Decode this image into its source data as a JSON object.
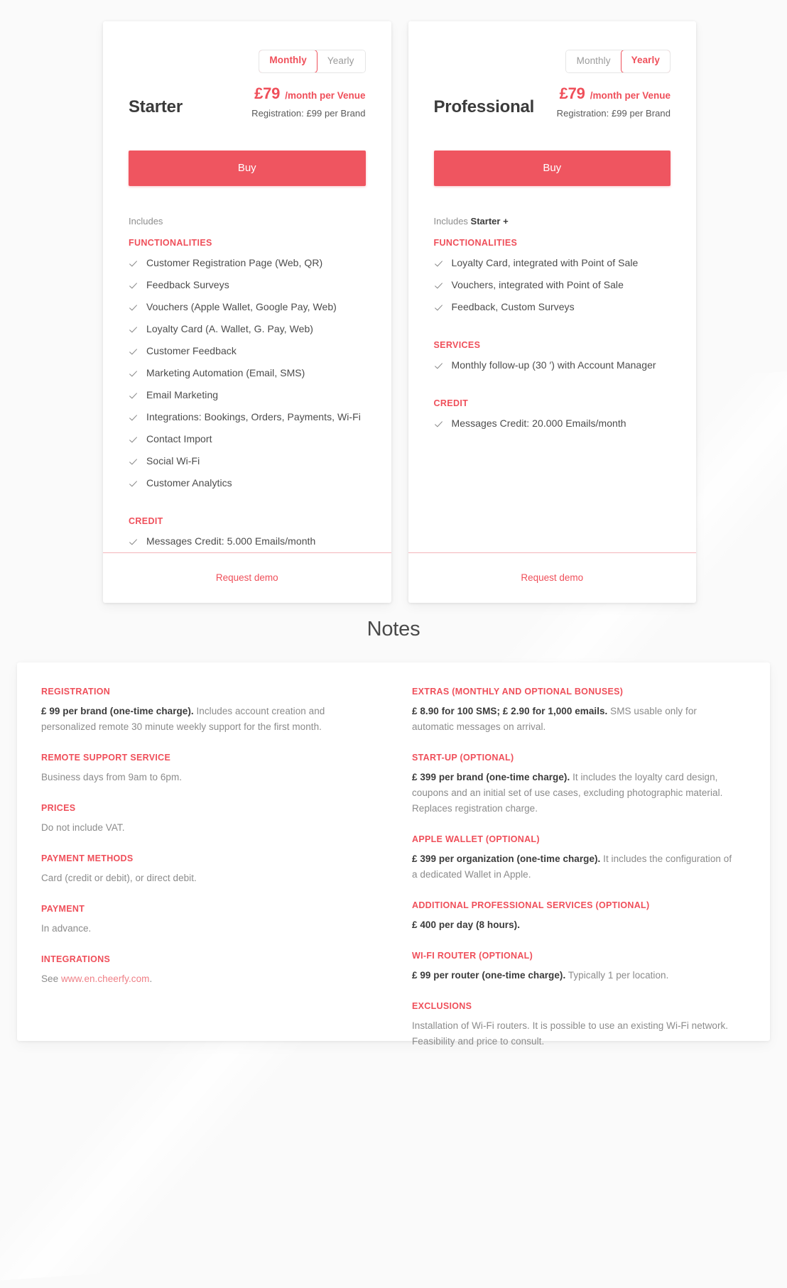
{
  "theme": {
    "accent": "#ef4f5a",
    "button": "#ef5560",
    "page_bg": "#fafafa",
    "card_bg": "#ffffff",
    "text": "#4c4c4c",
    "muted": "#8b8b8b"
  },
  "plans": [
    {
      "name": "Starter",
      "billing_toggle": {
        "monthly": "Monthly",
        "yearly": "Yearly",
        "selected": "Monthly"
      },
      "price_amount": "£79",
      "price_unit": "/month per Venue",
      "registration": "Registration: £99 per Brand",
      "buy_label": "Buy",
      "includes_prefix": "Includes",
      "includes_strong": "",
      "sections": [
        {
          "title": "FUNCTIONALITIES",
          "items": [
            "Customer Registration Page (Web, QR)",
            "Feedback Surveys",
            "Vouchers (Apple Wallet, Google Pay, Web)",
            "Loyalty Card (A. Wallet, G. Pay, Web)",
            "Customer Feedback",
            "Marketing Automation (Email, SMS)",
            "Email Marketing",
            "Integrations: Bookings, Orders, Payments, Wi-Fi",
            "Contact Import",
            "Social Wi-Fi",
            "Customer Analytics"
          ]
        },
        {
          "title": "CREDIT",
          "items": [
            "Messages Credit: 5.000 Emails/month"
          ]
        }
      ],
      "demo_label": "Request demo"
    },
    {
      "name": "Professional",
      "billing_toggle": {
        "monthly": "Monthly",
        "yearly": "Yearly",
        "selected": "Yearly"
      },
      "price_amount": "£79",
      "price_unit": "/month per Venue",
      "registration": "Registration: £99 per Brand",
      "buy_label": "Buy",
      "includes_prefix": "Includes",
      "includes_strong": "Starter +",
      "sections": [
        {
          "title": "FUNCTIONALITIES",
          "items": [
            "Loyalty Card, integrated with Point of Sale",
            "Vouchers, integrated with Point of Sale",
            "Feedback, Custom Surveys"
          ]
        },
        {
          "title": "SERVICES",
          "items": [
            "Monthly follow-up (30 ′) with Account Manager"
          ]
        },
        {
          "title": "CREDIT",
          "items": [
            "Messages Credit: 20.000 Emails/month"
          ]
        }
      ],
      "demo_label": "Request demo"
    }
  ],
  "notes": {
    "title": "Notes",
    "left": [
      {
        "head": "REGISTRATION",
        "strong": "£ 99 per brand (one-time charge).",
        "rest": " Includes account creation and personalized remote 30 minute weekly support for the first month."
      },
      {
        "head": "REMOTE SUPPORT SERVICE",
        "strong": "",
        "rest": "Business days from 9am to 6pm."
      },
      {
        "head": "PRICES",
        "strong": "",
        "rest": "Do not include VAT."
      },
      {
        "head": "PAYMENT METHODS",
        "strong": "",
        "rest": "Card (credit or debit), or direct debit."
      },
      {
        "head": "PAYMENT",
        "strong": "",
        "rest": "In advance."
      },
      {
        "head": "INTEGRATIONS",
        "strong": "",
        "rest": "See ",
        "link": "www.en.cheerfy.com",
        "after_link": "."
      }
    ],
    "right": [
      {
        "head": "EXTRAS (MONTHLY AND OPTIONAL BONUSES)",
        "strong": "£ 8.90 for 100 SMS; £ 2.90 for 1,000 emails.",
        "rest": " SMS usable only for automatic messages on arrival."
      },
      {
        "head": "START-UP (OPTIONAL)",
        "strong": "£ 399 per brand (one-time charge).",
        "rest": " It includes the loyalty card design, coupons and an initial set of use cases, excluding photographic material. Replaces registration charge."
      },
      {
        "head": "APPLE WALLET (OPTIONAL)",
        "strong": "£ 399 per organization (one-time charge).",
        "rest": " It includes the configuration of a dedicated Wallet in Apple."
      },
      {
        "head": "ADDITIONAL PROFESSIONAL SERVICES (OPTIONAL)",
        "strong": "£ 400 per day (8 hours).",
        "rest": ""
      },
      {
        "head": "WI-FI ROUTER (OPTIONAL)",
        "strong": "£ 99 per router (one-time charge).",
        "rest": " Typically 1 per location."
      },
      {
        "head": "EXCLUSIONS",
        "strong": "",
        "rest": "Installation of Wi-Fi routers. It is possible to use an existing Wi-Fi network. Feasibility and price to consult."
      }
    ]
  }
}
